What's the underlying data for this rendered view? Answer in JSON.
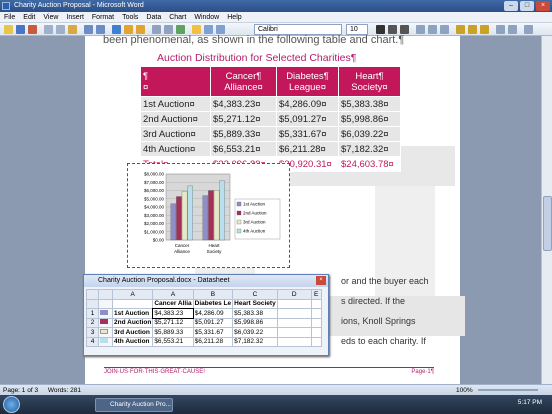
{
  "window": {
    "title": "Charity Auction Proposal - Microsoft Word"
  },
  "menu": [
    "File",
    "Edit",
    "View",
    "Insert",
    "Format",
    "Tools",
    "Data",
    "Chart",
    "Window",
    "Help"
  ],
  "toolbar": {
    "font_name": "Calibri",
    "font_size": "10"
  },
  "document": {
    "prev_text": "been phenomenal, as shown in the following table and chart.¶",
    "chart_title": "Auction Distribution for Selected Charities¶",
    "table": {
      "headers": [
        [
          "¶",
          "¤"
        ],
        [
          "Cancer¶",
          "Alliance¤"
        ],
        [
          "Diabetes¶",
          "League¤"
        ],
        [
          "Heart¶",
          "Society¤"
        ]
      ],
      "rows": [
        {
          "label": "1st Auction¤",
          "values": [
            "$4,383.23¤",
            "$4,286.09¤",
            "$5,383.38¤"
          ]
        },
        {
          "label": "2nd Auction¤",
          "values": [
            "$5,271.12¤",
            "$5,091.27¤",
            "$5,998.86¤"
          ]
        },
        {
          "label": "3rd Auction¤",
          "values": [
            "$5,889.33¤",
            "$5,331.67¤",
            "$6,039.22¤"
          ]
        },
        {
          "label": "4th Auction¤",
          "values": [
            "$6,553.21¤",
            "$6,211.28¤",
            "$7,182.32¤"
          ]
        }
      ],
      "total": {
        "label": "Total¤",
        "values": [
          "$22,096.89¤",
          "$20,920.31¤",
          "$24,603.78¤"
        ]
      }
    },
    "right_text": [
      "or and the buyer each",
      "s directed. If the",
      "ions, Knoll Springs",
      "eds to each charity. If"
    ],
    "footer_left": "JOIN·US·FOR·THIS·GREAT·CAUSE!",
    "footer_right": "Page·1¶"
  },
  "chart_data": {
    "type": "bar",
    "categories": [
      "Cancer Alliance",
      "Heart Society"
    ],
    "series": [
      {
        "name": "1st Auction",
        "values": [
          4383.23,
          5383.38
        ],
        "color": "#8e8ec8"
      },
      {
        "name": "2nd Auction",
        "values": [
          5271.12,
          5998.86
        ],
        "color": "#a4305c"
      },
      {
        "name": "3rd Auction",
        "values": [
          5889.33,
          6039.22
        ],
        "color": "#e8e8c8"
      },
      {
        "name": "4th Auction",
        "values": [
          6553.21,
          7182.32
        ],
        "color": "#b8e0ec"
      }
    ],
    "ylim": [
      0,
      8000
    ],
    "yticks": [
      "$0.00",
      "$1,000.00",
      "$2,000.00",
      "$3,000.00",
      "$4,000.00",
      "$5,000.00",
      "$6,000.00",
      "$7,000.00",
      "$8,000.00"
    ],
    "legend": "right"
  },
  "datasheet": {
    "title": "Charity Auction Proposal.docx - Datasheet",
    "columns": [
      "",
      "",
      "A",
      "B",
      "C",
      "D",
      "E"
    ],
    "header_row": [
      "",
      "",
      "Cancer Allia",
      "Diabetes Le",
      "Heart Society",
      "",
      ""
    ],
    "rows": [
      {
        "n": "1",
        "label": "1st Auction",
        "vals": [
          "$4,383.23",
          "$4,286.09",
          "$5,383.38"
        ]
      },
      {
        "n": "2",
        "label": "2nd Auction",
        "vals": [
          "$5,271.12",
          "$5,091.27",
          "$5,998.86"
        ]
      },
      {
        "n": "3",
        "label": "3rd Auction",
        "vals": [
          "$5,889.33",
          "$5,331.67",
          "$6,039.22"
        ]
      },
      {
        "n": "4",
        "label": "4th Auction",
        "vals": [
          "$6,553.21",
          "$6,211.28",
          "$7,182.32"
        ]
      }
    ]
  },
  "status": {
    "page": "Page: 1 of 3",
    "words": "Words: 281",
    "zoom": "100%"
  },
  "taskbar": {
    "task": "Charity Auction Pro...",
    "clock": "5:17 PM"
  }
}
